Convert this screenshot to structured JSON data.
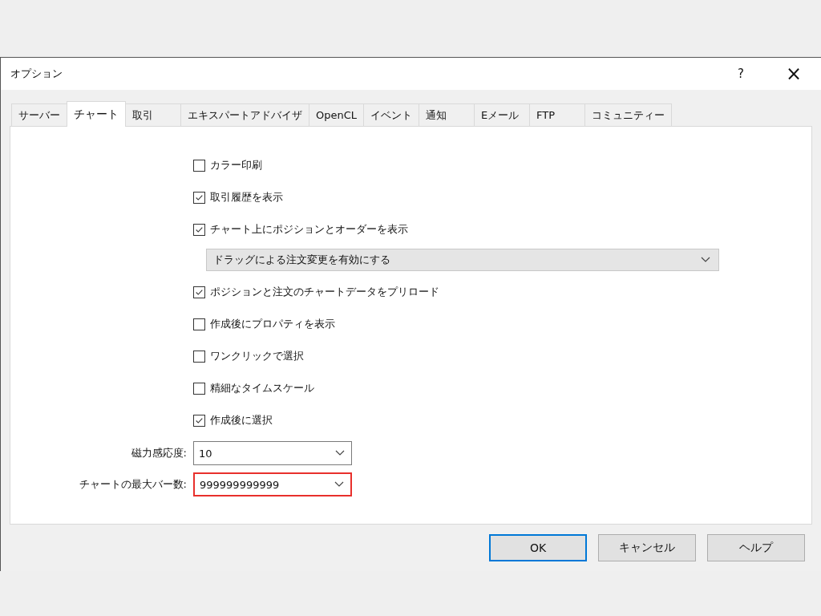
{
  "window": {
    "title": "オプション",
    "help": "?",
    "close": "×"
  },
  "tabs": [
    {
      "label": "サーバー",
      "selected": false
    },
    {
      "label": "チャート",
      "selected": true
    },
    {
      "label": "取引",
      "selected": false
    },
    {
      "label": "エキスパートアドバイザ",
      "selected": false
    },
    {
      "label": "OpenCL",
      "selected": false
    },
    {
      "label": "イベント",
      "selected": false
    },
    {
      "label": "通知",
      "selected": false
    },
    {
      "label": "Eメール",
      "selected": false
    },
    {
      "label": "FTP",
      "selected": false
    },
    {
      "label": "コミュニティー",
      "selected": false
    }
  ],
  "options": [
    {
      "kind": "checkbox",
      "label": "カラー印刷",
      "checked": false
    },
    {
      "kind": "checkbox",
      "label": "取引履歴を表示",
      "checked": true
    },
    {
      "kind": "checkbox",
      "label": "チャート上にポジションとオーダーを表示",
      "checked": true
    },
    {
      "kind": "dropdown",
      "value": "ドラッグによる注文変更を有効にする"
    },
    {
      "kind": "checkbox",
      "label": "ポジションと注文のチャートデータをプリロード",
      "checked": true
    },
    {
      "kind": "checkbox",
      "label": "作成後にプロパティを表示",
      "checked": false
    },
    {
      "kind": "checkbox",
      "label": "ワンクリックで選択",
      "checked": false
    },
    {
      "kind": "checkbox",
      "label": "精細なタイムスケール",
      "checked": false
    },
    {
      "kind": "checkbox",
      "label": "作成後に選択",
      "checked": true
    }
  ],
  "fields": [
    {
      "label": "磁力感応度:",
      "value": "10",
      "highlighted": false
    },
    {
      "label": "チャートの最大バー数:",
      "value": "999999999999",
      "highlighted": true
    }
  ],
  "buttons": [
    {
      "label": "OK",
      "default": true
    },
    {
      "label": "キャンセル",
      "default": false
    },
    {
      "label": "ヘルプ",
      "default": false
    }
  ]
}
